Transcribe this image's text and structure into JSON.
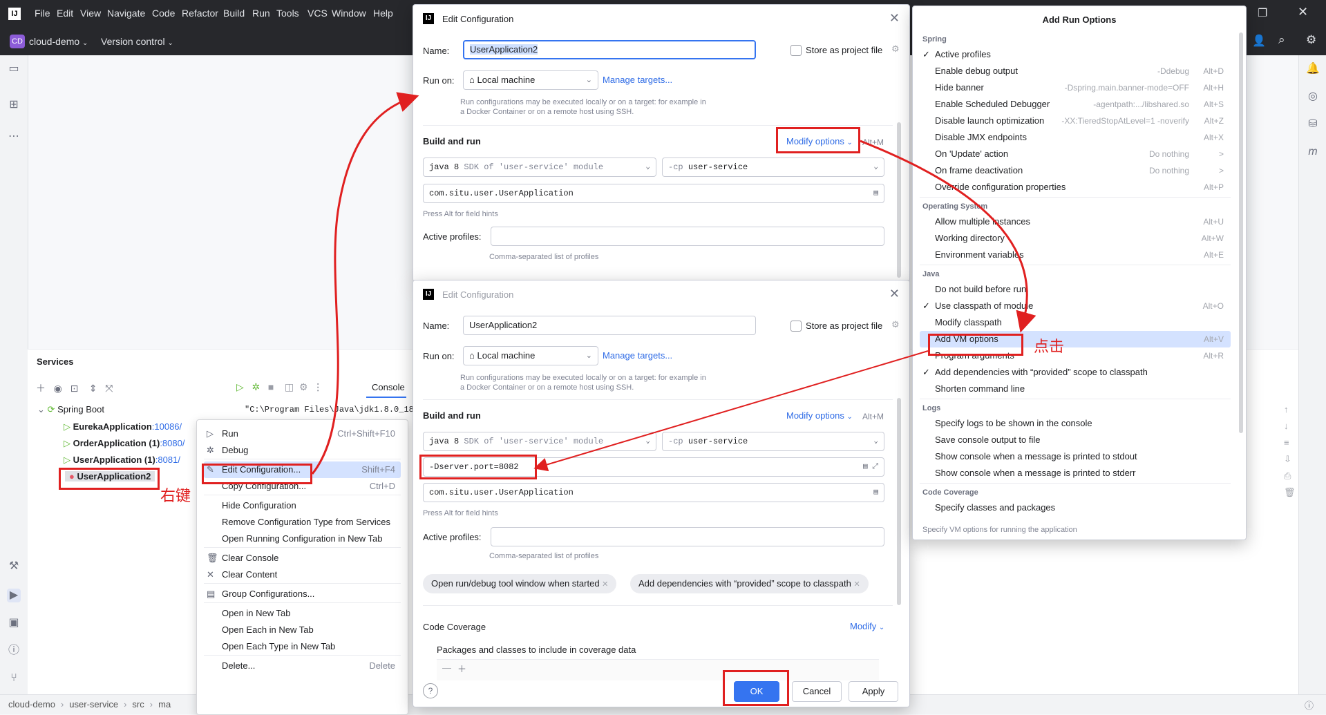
{
  "menubar": {
    "items": [
      "File",
      "Edit",
      "View",
      "Navigate",
      "Code",
      "Refactor",
      "Build",
      "Run",
      "Tools",
      "VCS",
      "Window",
      "Help"
    ]
  },
  "toolbar": {
    "project_badge": "CD",
    "project_name": "cloud-demo",
    "vcs": "Version control"
  },
  "services": {
    "title": "Services",
    "root": "Spring Boot",
    "apps": [
      {
        "name": "EurekaApplication",
        "port": ":10086/"
      },
      {
        "name": "OrderApplication (1)",
        "port": ":8080/"
      },
      {
        "name": "UserApplication (1)",
        "port": ":8081/"
      },
      {
        "name": "UserApplication2",
        "port": ""
      }
    ],
    "console_tab": "Console",
    "console_line1": "\"C:\\Program Files\\Java\\jdk1.8.0_18"
  },
  "annotations": {
    "right_click": "右键",
    "click": "点击"
  },
  "context_menu": {
    "items": [
      {
        "label": "Run",
        "shortcut": "Ctrl+Shift+F10"
      },
      {
        "label": "Debug",
        "shortcut": ""
      },
      {
        "label": "Edit Configuration...",
        "shortcut": "Shift+F4"
      },
      {
        "label": "Copy Configuration...",
        "shortcut": "Ctrl+D"
      },
      {
        "label": "Hide Configuration",
        "shortcut": ""
      },
      {
        "label": "Remove Configuration Type from Services",
        "shortcut": ""
      },
      {
        "label": "Open Running Configuration in New Tab",
        "shortcut": ""
      },
      {
        "label": "Clear Console",
        "shortcut": ""
      },
      {
        "label": "Clear Content",
        "shortcut": ""
      },
      {
        "label": "Group Configurations...",
        "shortcut": ""
      },
      {
        "label": "Open in New Tab",
        "shortcut": ""
      },
      {
        "label": "Open Each in New Tab",
        "shortcut": ""
      },
      {
        "label": "Open Each Type in New Tab",
        "shortcut": ""
      },
      {
        "label": "Delete...",
        "shortcut": "Delete"
      }
    ]
  },
  "edit_config_top": {
    "title": "Edit Configuration",
    "name_label": "Name:",
    "name_value": "UserApplication2",
    "store_label": "Store as project file",
    "run_on_label": "Run on:",
    "run_on_value": "Local machine",
    "manage_targets": "Manage targets...",
    "run_hint": "Run configurations may be executed locally or on a target: for example in a Docker Container or on a remote host using SSH.",
    "build_and_run": "Build and run",
    "modify_options": "Modify options",
    "modify_shortcut": "Alt+M",
    "jdk_value": "java 8",
    "jdk_hint": "SDK of 'user-service' module",
    "cp_prefix": "-cp",
    "cp_value": "user-service",
    "main_class": "com.situ.user.UserApplication",
    "field_hint": "Press Alt for field hints",
    "active_profiles_label": "Active profiles:",
    "profiles_hint": "Comma-separated list of profiles"
  },
  "edit_config_bottom": {
    "title": "Edit Configuration",
    "name_label": "Name:",
    "name_value": "UserApplication2",
    "store_label": "Store as project file",
    "run_on_label": "Run on:",
    "run_on_value": "Local machine",
    "manage_targets": "Manage targets...",
    "run_hint": "Run configurations may be executed locally or on a target: for example in a Docker Container or on a remote host using SSH.",
    "build_and_run": "Build and run",
    "modify_options": "Modify options",
    "modify_shortcut": "Alt+M",
    "jdk_value": "java 8",
    "jdk_hint": "SDK of 'user-service' module",
    "cp_prefix": "-cp",
    "cp_value": "user-service",
    "vm_options": "-Dserver.port=8082",
    "main_class": "com.situ.user.UserApplication",
    "field_hint": "Press Alt for field hints",
    "active_profiles_label": "Active profiles:",
    "profiles_hint": "Comma-separated list of profiles",
    "chip1": "Open run/debug tool window when started",
    "chip2": "Add dependencies with “provided” scope to classpath",
    "code_coverage": "Code Coverage",
    "modify": "Modify",
    "packages_label": "Packages and classes to include in coverage data",
    "ok": "OK",
    "cancel": "Cancel",
    "apply": "Apply"
  },
  "add_run_options": {
    "title": "Add Run Options",
    "footer": "Specify VM options for running the application",
    "groups": [
      {
        "name": "Spring",
        "items": [
          {
            "label": "Active profiles",
            "checked": true,
            "flag": "",
            "key": ""
          },
          {
            "label": "Enable debug output",
            "checked": false,
            "flag": "-Ddebug",
            "key": "Alt+D"
          },
          {
            "label": "Hide banner",
            "checked": false,
            "flag": "-Dspring.main.banner-mode=OFF",
            "key": "Alt+H"
          },
          {
            "label": "Enable Scheduled Debugger",
            "checked": false,
            "flag": "-agentpath:.../libshared.so",
            "key": "Alt+S"
          },
          {
            "label": "Disable launch optimization",
            "checked": false,
            "flag": "-XX:TieredStopAtLevel=1 -noverify",
            "key": "Alt+Z"
          },
          {
            "label": "Disable JMX endpoints",
            "checked": false,
            "flag": "",
            "key": "Alt+X"
          },
          {
            "label": "On 'Update' action",
            "checked": false,
            "flag": "Do nothing",
            "key": ">"
          },
          {
            "label": "On frame deactivation",
            "checked": false,
            "flag": "Do nothing",
            "key": ">"
          },
          {
            "label": "Override configuration properties",
            "checked": false,
            "flag": "",
            "key": "Alt+P"
          }
        ]
      },
      {
        "name": "Operating System",
        "items": [
          {
            "label": "Allow multiple instances",
            "checked": false,
            "flag": "",
            "key": "Alt+U"
          },
          {
            "label": "Working directory",
            "checked": false,
            "flag": "",
            "key": "Alt+W"
          },
          {
            "label": "Environment variables",
            "checked": false,
            "flag": "",
            "key": "Alt+E"
          }
        ]
      },
      {
        "name": "Java",
        "items": [
          {
            "label": "Do not build before run",
            "checked": false,
            "flag": "",
            "key": ""
          },
          {
            "label": "Use classpath of module",
            "checked": true,
            "flag": "",
            "key": "Alt+O"
          },
          {
            "label": "Modify classpath",
            "checked": false,
            "flag": "",
            "key": ""
          },
          {
            "label": "Add VM options",
            "checked": false,
            "flag": "",
            "key": "Alt+V"
          },
          {
            "label": "Program arguments",
            "checked": false,
            "flag": "",
            "key": "Alt+R"
          },
          {
            "label": "Add dependencies with “provided” scope to classpath",
            "checked": true,
            "flag": "",
            "key": ""
          },
          {
            "label": "Shorten command line",
            "checked": false,
            "flag": "",
            "key": ""
          }
        ]
      },
      {
        "name": "Logs",
        "items": [
          {
            "label": "Specify logs to be shown in the console",
            "checked": false,
            "flag": "",
            "key": ""
          },
          {
            "label": "Save console output to file",
            "checked": false,
            "flag": "",
            "key": ""
          },
          {
            "label": "Show console when a message is printed to stdout",
            "checked": false,
            "flag": "",
            "key": ""
          },
          {
            "label": "Show console when a message is printed to stderr",
            "checked": false,
            "flag": "",
            "key": ""
          }
        ]
      },
      {
        "name": "Code Coverage",
        "items": [
          {
            "label": "Specify classes and packages",
            "checked": false,
            "flag": "",
            "key": ""
          }
        ]
      }
    ]
  },
  "statusbar": {
    "crumbs": [
      "cloud-demo",
      "user-service",
      "src",
      "ma"
    ]
  }
}
